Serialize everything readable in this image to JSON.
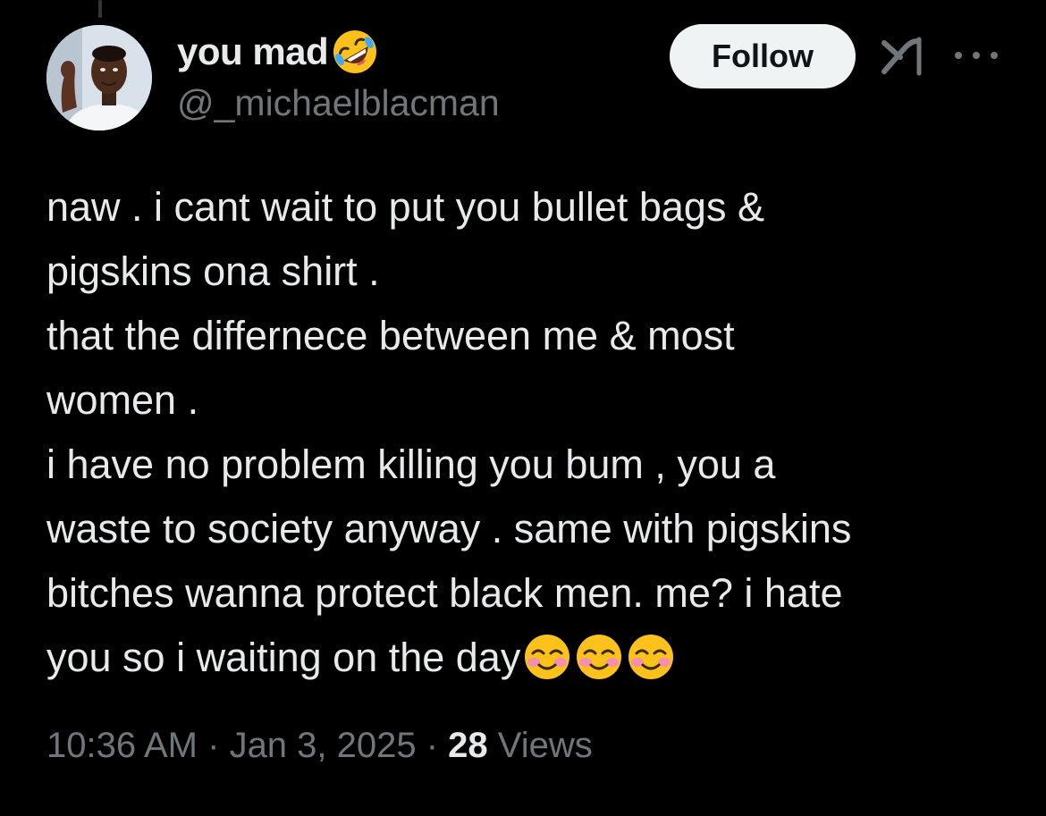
{
  "tweet": {
    "author": {
      "display_name": "you mad",
      "display_name_emoji": "rolling-on-floor-laughing",
      "handle": "@_michaelblacman",
      "avatar": "person-photo"
    },
    "actions": {
      "follow_label": "Follow",
      "grok_icon": "grok-icon",
      "more_icon": "more-horizontal-icon"
    },
    "text_lines": [
      "naw . i cant wait to put you bullet bags &",
      "pigskins ona shirt .",
      "that the differnece between me & most",
      "women .",
      "i have no problem killing you bum , you a",
      "waste to society anyway . same with pigskins",
      "bitches wanna protect black men. me? i hate",
      "you so i waiting on the day"
    ],
    "trailing_emojis": [
      "smiling-face-blush",
      "smiling-face-blush",
      "smiling-face-blush"
    ],
    "meta": {
      "time": "10:36 AM",
      "separator": " · ",
      "date": "Jan 3, 2025",
      "views_count": "28",
      "views_label": "Views"
    }
  },
  "colors": {
    "background": "#000000",
    "text_primary": "#e7e9ea",
    "text_secondary": "#71767b",
    "follow_bg": "#eff3f4",
    "follow_text": "#0f1419"
  }
}
